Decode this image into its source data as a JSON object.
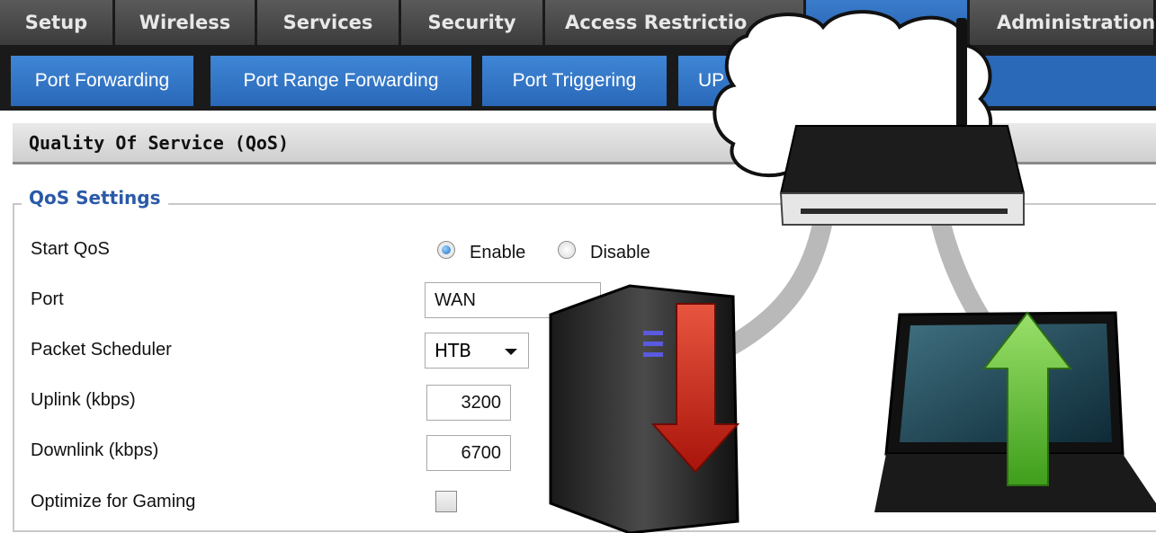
{
  "top_tabs": [
    {
      "label": "Setup",
      "active": false
    },
    {
      "label": "Wireless",
      "active": false
    },
    {
      "label": "Services",
      "active": false
    },
    {
      "label": "Security",
      "active": false
    },
    {
      "label": "Access Restrictio",
      "active": false
    },
    {
      "label": "",
      "active": true
    },
    {
      "label": "Administration",
      "active": false
    }
  ],
  "sub_tabs": [
    "Port Forwarding",
    "Port Range Forwarding",
    "Port Triggering",
    "UP"
  ],
  "section": {
    "title": "Quality Of Service (QoS)"
  },
  "qos": {
    "legend": "QoS Settings",
    "start_qos": {
      "label": "Start QoS",
      "options": [
        "Enable",
        "Disable"
      ],
      "selected": "Enable"
    },
    "port": {
      "label": "Port",
      "value": "WAN"
    },
    "scheduler": {
      "label": "Packet Scheduler",
      "value": "HTB"
    },
    "uplink": {
      "label": "Uplink (kbps)",
      "value": "3200"
    },
    "downlink": {
      "label": "Downlink (kbps)",
      "value": "6700"
    },
    "gaming": {
      "label": "Optimize for Gaming",
      "checked": false
    }
  },
  "colors": {
    "accent_blue": "#2a68b8",
    "download_arrow": "#cc1f12",
    "upload_arrow": "#5cbf2a"
  }
}
